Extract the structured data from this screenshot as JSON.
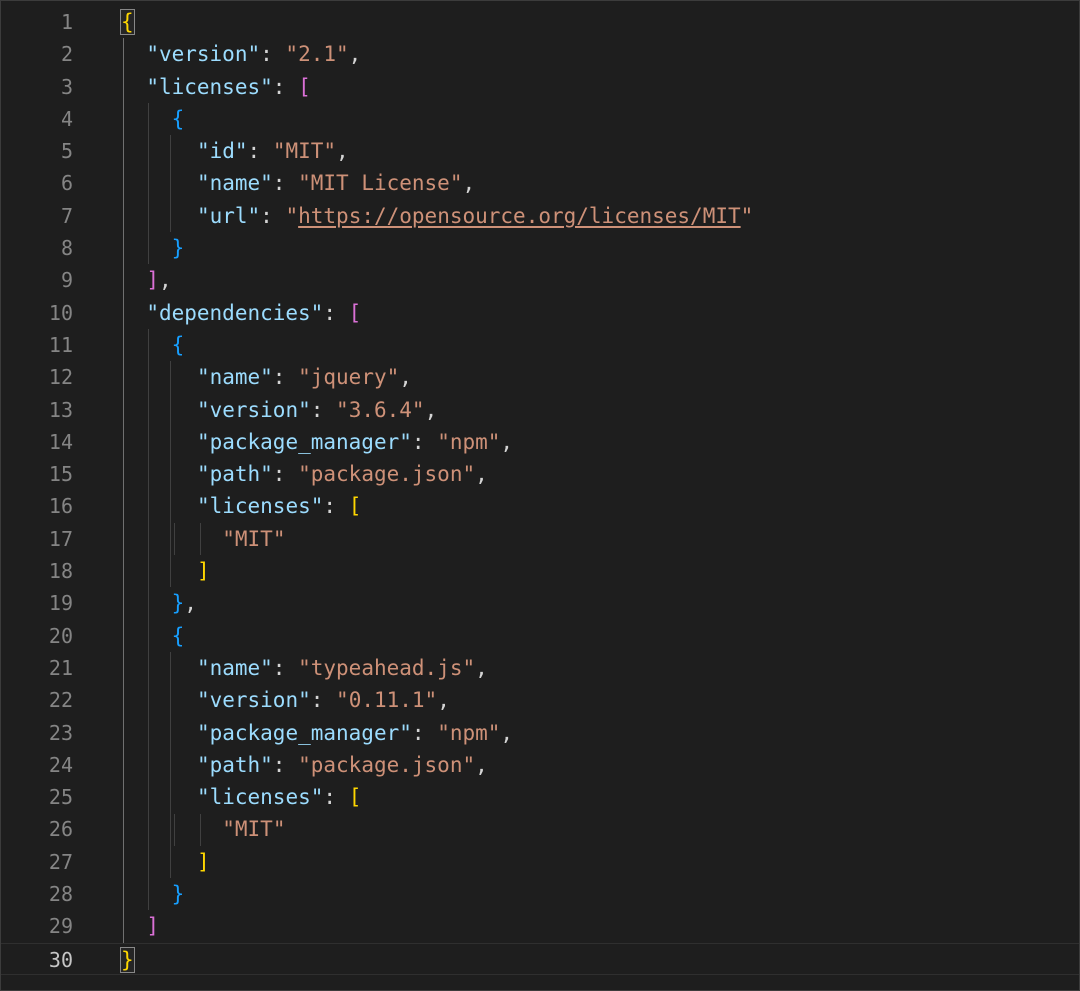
{
  "editor": {
    "active_line": 30,
    "lines": [
      {
        "n": "1",
        "t": "{"
      },
      {
        "n": "2",
        "t": "  \"version\": \"2.1\","
      },
      {
        "n": "3",
        "t": "  \"licenses\": ["
      },
      {
        "n": "4",
        "t": "    {"
      },
      {
        "n": "5",
        "t": "      \"id\": \"MIT\","
      },
      {
        "n": "6",
        "t": "      \"name\": \"MIT License\","
      },
      {
        "n": "7",
        "t": "      \"url\": \"https://opensource.org/licenses/MIT\""
      },
      {
        "n": "8",
        "t": "    }"
      },
      {
        "n": "9",
        "t": "  ],"
      },
      {
        "n": "10",
        "t": "  \"dependencies\": ["
      },
      {
        "n": "11",
        "t": "    {"
      },
      {
        "n": "12",
        "t": "      \"name\": \"jquery\","
      },
      {
        "n": "13",
        "t": "      \"version\": \"3.6.4\","
      },
      {
        "n": "14",
        "t": "      \"package_manager\": \"npm\","
      },
      {
        "n": "15",
        "t": "      \"path\": \"package.json\","
      },
      {
        "n": "16",
        "t": "      \"licenses\": ["
      },
      {
        "n": "17",
        "t": "        \"MIT\""
      },
      {
        "n": "18",
        "t": "      ]"
      },
      {
        "n": "19",
        "t": "    },"
      },
      {
        "n": "20",
        "t": "    {"
      },
      {
        "n": "21",
        "t": "      \"name\": \"typeahead.js\","
      },
      {
        "n": "22",
        "t": "      \"version\": \"0.11.1\","
      },
      {
        "n": "23",
        "t": "      \"package_manager\": \"npm\","
      },
      {
        "n": "24",
        "t": "      \"path\": \"package.json\","
      },
      {
        "n": "25",
        "t": "      \"licenses\": ["
      },
      {
        "n": "26",
        "t": "        \"MIT\""
      },
      {
        "n": "27",
        "t": "      ]"
      },
      {
        "n": "28",
        "t": "    }"
      },
      {
        "n": "29",
        "t": "  ]"
      },
      {
        "n": "30",
        "t": "}"
      }
    ]
  },
  "theme": {
    "background": "#1e1e1e",
    "key_color": "#9cdcfe",
    "string_color": "#ce9178",
    "bracket_level1": "#ffd700",
    "bracket_level2": "#da70d6",
    "bracket_level3": "#179fff",
    "line_number_color": "#858585"
  }
}
